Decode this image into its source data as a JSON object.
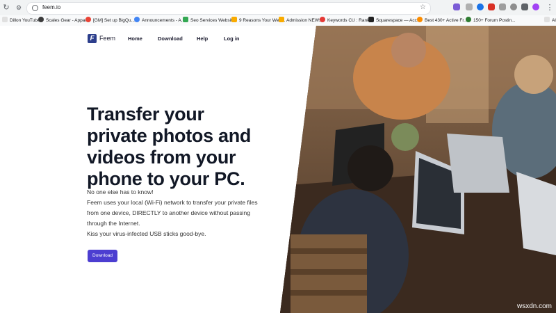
{
  "browser": {
    "url": "feem.io",
    "bookmarks": [
      "Dillon YouTube",
      "Scales Gear - Appar...",
      "[GM] Set up BigQu...",
      "Announcements - A...",
      "Seo Services Websit...",
      "9 Reasons Your Web...",
      "Admission NEWS",
      "Keywords CU : Rank...",
      "Squarespace — Acc...",
      "Best 430+ Active Fr...",
      "150+ Forum Postin...",
      "Al"
    ]
  },
  "site": {
    "logo_letter": "F",
    "logo_text": "Feem",
    "nav": [
      "Home",
      "Download",
      "Help",
      "Log in"
    ]
  },
  "hero": {
    "lines": [
      "Transfer your",
      "private photos and",
      "videos from your",
      "phone to your PC."
    ]
  },
  "body": {
    "lines": [
      "No one else has to know!",
      "Feem uses your local (Wi-Fi) network to transfer your private files",
      "from one device, DIRECTLY to another device without passing",
      "through the Internet.",
      "Kiss your virus-infected USB sticks good-bye."
    ]
  },
  "cta": {
    "label": "Download"
  },
  "watermark": "wsxdn.com",
  "colors": {
    "accent": "#4c3ed1",
    "logo": "#2c3e8c",
    "heading": "#121826"
  }
}
